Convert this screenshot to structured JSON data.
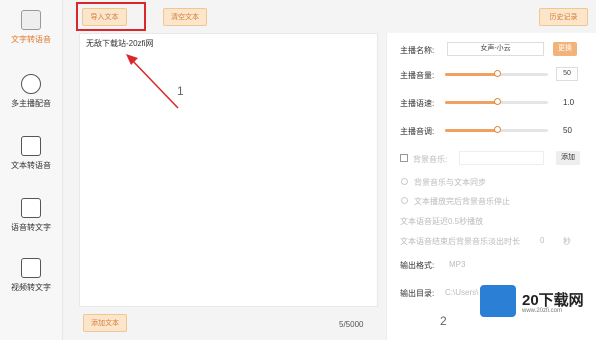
{
  "sidebar": {
    "items": [
      {
        "label": "文字转语音",
        "active": true
      },
      {
        "label": "多主播配音"
      },
      {
        "label": "文本转语音"
      },
      {
        "label": "语音转文字"
      },
      {
        "label": "视频转文字"
      }
    ]
  },
  "toolbar": {
    "import_label": "导入文本",
    "clear_label": "清空文本",
    "history_label": "历史记录"
  },
  "editor": {
    "text": "无敌下载站-20zfi网",
    "char_count": "5/5000",
    "bottom_button": "添加文本"
  },
  "panel": {
    "anchor_name_label": "主播名称:",
    "anchor_name_value": "女声-小云",
    "change_label": "更换",
    "volume_label": "主播音量:",
    "volume_value": "50",
    "volume_fraction": 0.5,
    "speed_label": "主播语速:",
    "speed_value": "1.0",
    "speed_fraction": 0.5,
    "pitch_label": "主播音调:",
    "pitch_value": "50",
    "pitch_fraction": 0.5,
    "bgm_label": "背景音乐:",
    "add_label": "添加",
    "opt1": "背景音乐与文本同步",
    "opt2": "文本播放完后背景音乐停止",
    "opt3": "文本语音延迟0.5秒播放",
    "opt4": "文本语音结束后背景音乐淡出时长",
    "opt4_value": "0",
    "opt4_unit": "秒",
    "format_label": "输出格式:",
    "format_value": "MP3",
    "dir_label": "输出目录:",
    "dir_value": "C:\\Users\\"
  },
  "annotations": {
    "n1": "1",
    "n2": "2"
  },
  "watermark": {
    "brand": "20下载网",
    "url": "www.20zfi.com"
  },
  "colors": {
    "accent": "#e07a2e",
    "highlight": "#d9272b",
    "logo_blue": "#2b7fd4"
  }
}
